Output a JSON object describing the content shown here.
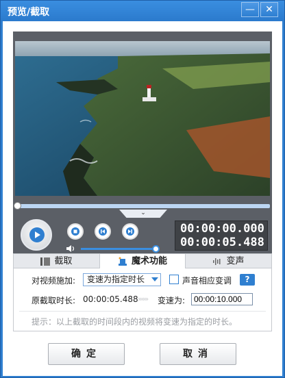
{
  "window": {
    "title": "预览/截取",
    "minimize": "—",
    "close": "✕"
  },
  "player": {
    "current_time": "00:00:00.000",
    "total_time": "00:00:05.488",
    "collapse_glyph": "⌄",
    "video_description_icon": "coastline-lighthouse-video-frame"
  },
  "tabs": [
    {
      "label": "截取",
      "icon": "film-icon"
    },
    {
      "label": "魔术功能",
      "icon": "magic-hat-icon",
      "active": true
    },
    {
      "label": "变声",
      "icon": "audio-wave-icon"
    }
  ],
  "magic": {
    "apply_label": "对视频施加:",
    "mode_value": "变速为指定时长",
    "pitch_checkbox_label": "声音相应变调",
    "pitch_checked": false,
    "help_label": "?",
    "orig_duration_label": "原截取时长:",
    "orig_duration_value": "00:00:05.488",
    "arrows": "»»»",
    "speed_label": "变速为:",
    "speed_value": "00:00:10.000",
    "hint": "提示：以上截取的时间段内的视频将变速为指定的时长。"
  },
  "buttons": {
    "ok": "确定",
    "cancel": "取消"
  },
  "colors": {
    "accent": "#2f7fd0",
    "timebox": "#3f4246"
  }
}
